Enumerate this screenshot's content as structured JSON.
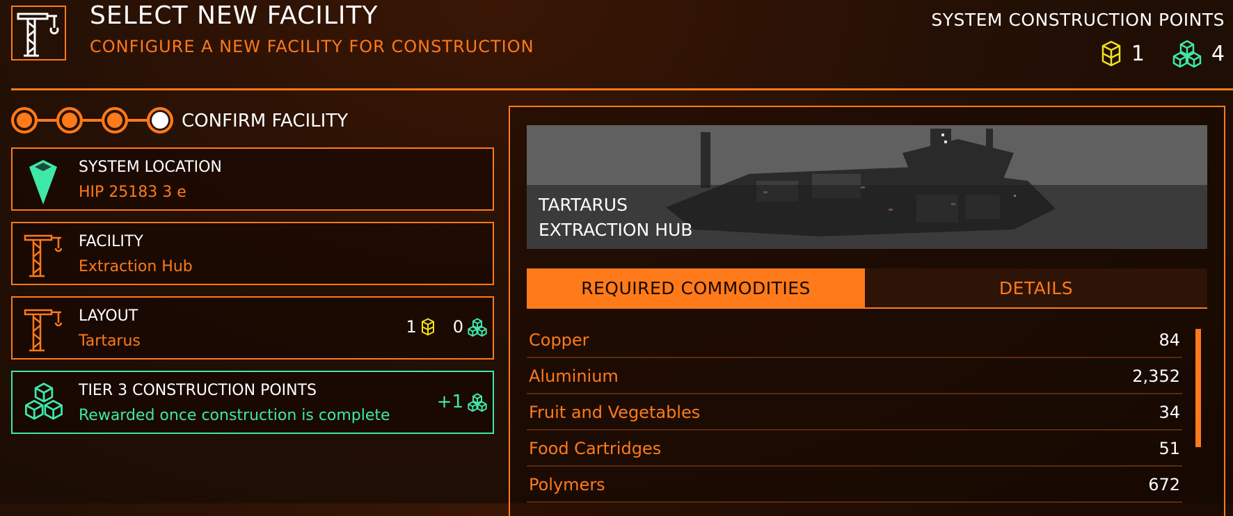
{
  "header": {
    "title": "SELECT NEW FACILITY",
    "subtitle": "CONFIGURE A NEW FACILITY FOR CONSTRUCTION",
    "construction_points_label": "SYSTEM CONSTRUCTION POINTS",
    "tier2_points": "1",
    "tier3_points": "4"
  },
  "steps": {
    "current_label": "CONFIRM FACILITY"
  },
  "cards": {
    "location": {
      "title": "SYSTEM LOCATION",
      "value": "HIP 25183 3 e"
    },
    "facility": {
      "title": "FACILITY",
      "value": "Extraction Hub"
    },
    "layout": {
      "title": "LAYOUT",
      "value": "Tartarus",
      "tier2_cost": "1",
      "tier3_cost": "0"
    },
    "reward": {
      "title": "TIER 3 CONSTRUCTION POINTS",
      "value": "Rewarded once construction is complete",
      "points": "+1"
    }
  },
  "preview": {
    "line1": "TARTARUS",
    "line2": "EXTRACTION HUB"
  },
  "tabs": {
    "required": "REQUIRED COMMODITIES",
    "details": "DETAILS"
  },
  "commodities": [
    {
      "name": "Copper",
      "qty": "84"
    },
    {
      "name": "Aluminium",
      "qty": "2,352"
    },
    {
      "name": "Fruit and Vegetables",
      "qty": "34"
    },
    {
      "name": "Food Cartridges",
      "qty": "51"
    },
    {
      "name": "Polymers",
      "qty": "672"
    }
  ],
  "colors": {
    "accent": "#ff7a1a",
    "tier2": "#f2e21c",
    "tier3": "#3ee8a8"
  },
  "icons": {
    "header": "crane-icon",
    "location": "location-marker-icon",
    "facility": "crane-icon",
    "layout": "crane-icon",
    "reward": "cube-cluster-icon",
    "tier2": "hex-cube-icon",
    "tier3": "cube-cluster-icon"
  }
}
